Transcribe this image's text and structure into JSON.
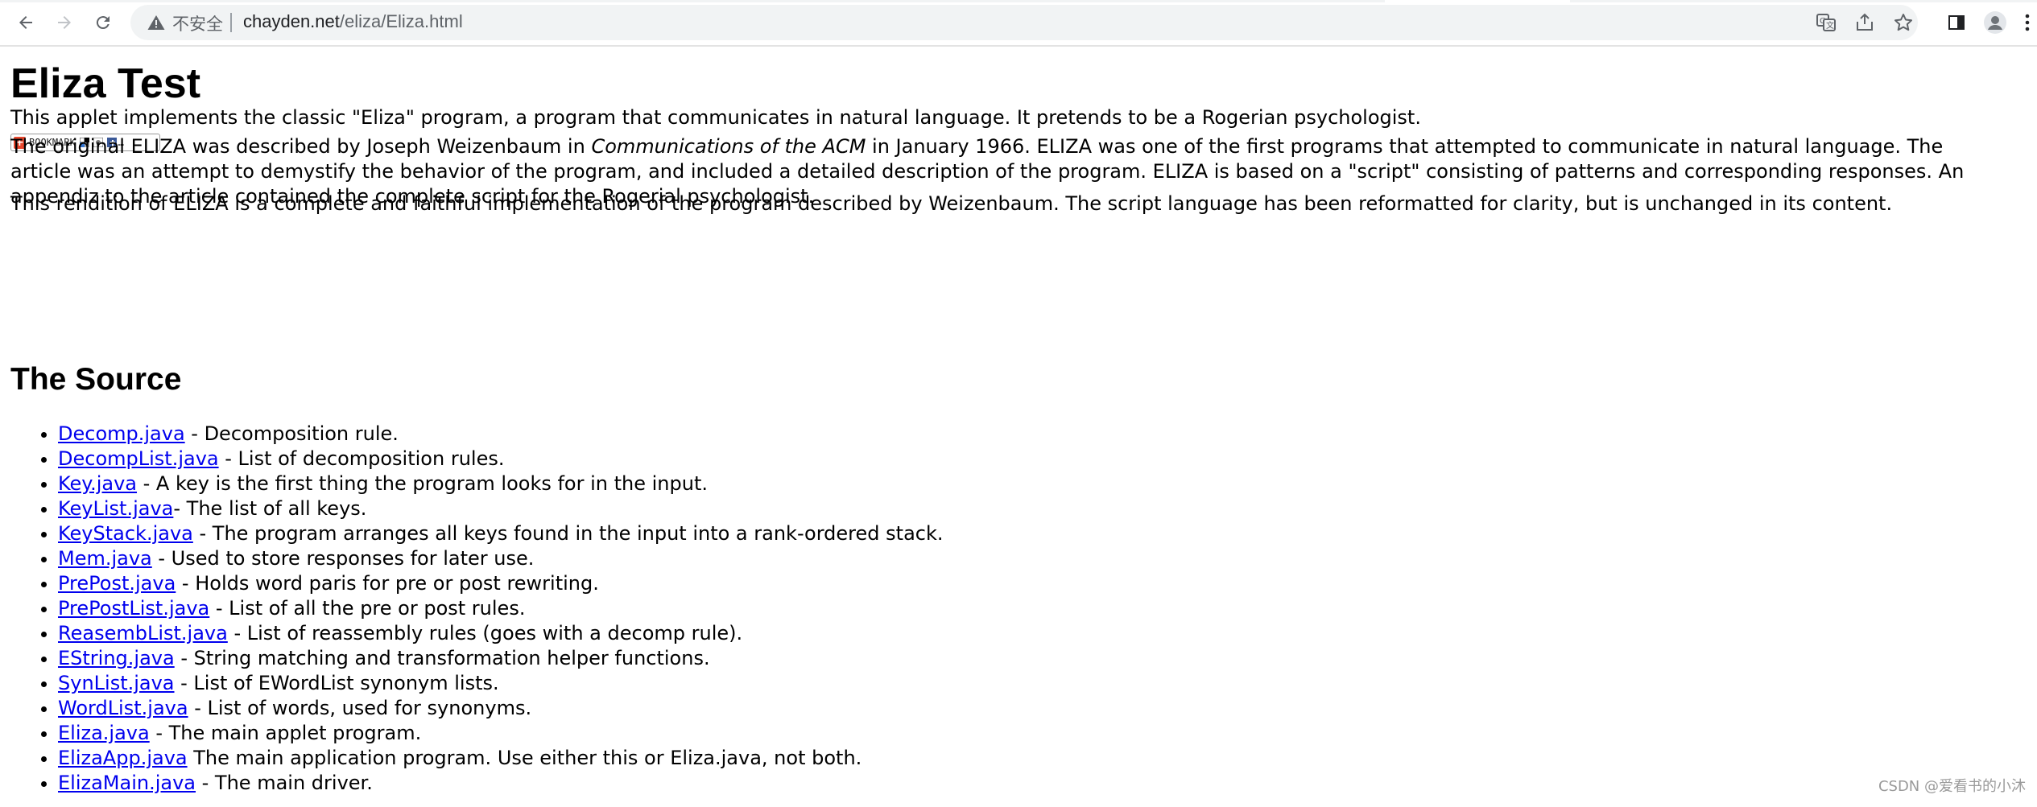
{
  "browser": {
    "insecure_label": "不安全",
    "url_host": "chayden.net",
    "url_path": "/eliza/Eliza.html"
  },
  "page": {
    "title": "Eliza Test",
    "bookmark_label": "BOOKMARK",
    "intro": "This applet implements the classic \"Eliza\" program, a program that communicates in natural language. It pretends to be a Rogerian psychologist.",
    "para2_before": "The original ELIZA was described by Joseph Weizenbaum in ",
    "para2_italic": "Communications of the ACM",
    "para2_after": " in January 1966. ELIZA was one of the first programs that attempted to communicate in natural language. The article was an attempt to demystify the behavior of the program, and included a detailed description of the program. ELIZA is based on a \"script\" consisting of patterns and corresponding responses. An appendiz to the article contained the complete script for the Rogerial psychologist.",
    "para3": "This rendition of ELIZA is a complete and faithful implementation of the program described by Weizenbaum. The script language has been reformatted for clarity, but is unchanged in its content.",
    "source_heading": "The Source",
    "files": [
      {
        "name": "Decomp.java",
        "desc": " - Decomposition rule."
      },
      {
        "name": "DecompList.java",
        "desc": " - List of decomposition rules."
      },
      {
        "name": "Key.java",
        "desc": " - A key is the first thing the program looks for in the input."
      },
      {
        "name": "KeyList.java",
        "desc": "- The list of all keys."
      },
      {
        "name": "KeyStack.java",
        "desc": " - The program arranges all keys found in the input into a rank-ordered stack."
      },
      {
        "name": "Mem.java",
        "desc": " - Used to store responses for later use."
      },
      {
        "name": "PrePost.java",
        "desc": " - Holds word paris for pre or post rewriting."
      },
      {
        "name": "PrePostList.java",
        "desc": " - List of all the pre or post rules."
      },
      {
        "name": "ReasembList.java",
        "desc": " - List of reassembly rules (goes with a decomp rule)."
      },
      {
        "name": "EString.java",
        "desc": " - String matching and transformation helper functions."
      },
      {
        "name": "SynList.java",
        "desc": " - List of EWordList synonym lists."
      },
      {
        "name": "WordList.java",
        "desc": " - List of words, used for synonyms."
      },
      {
        "name": "Eliza.java",
        "desc": " - The main applet program."
      },
      {
        "name": "ElizaApp.java",
        "desc": " The main application program. Use either this or Eliza.java, not both."
      },
      {
        "name": "ElizaMain.java",
        "desc": " - The main driver."
      }
    ]
  },
  "watermark": "CSDN @爱看书的小沐"
}
